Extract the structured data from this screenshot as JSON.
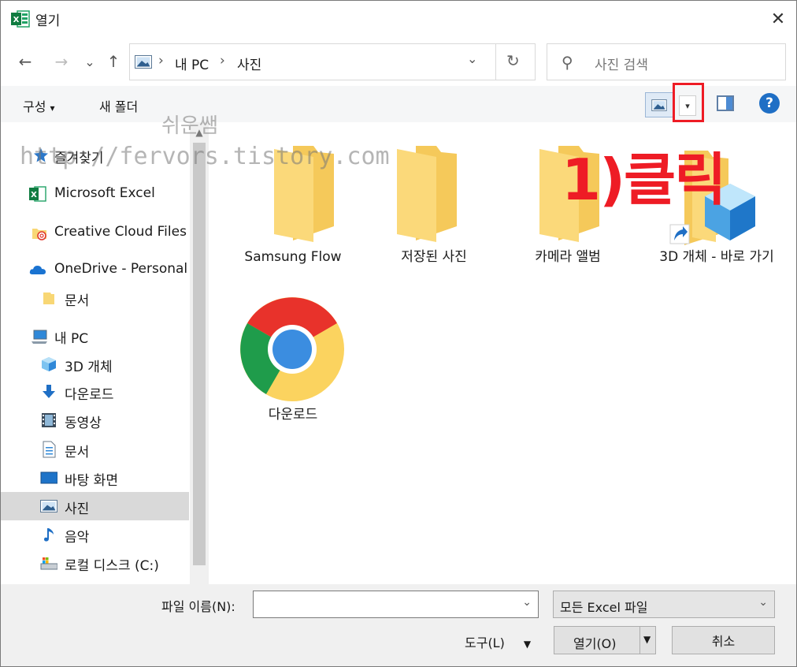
{
  "window": {
    "title": "열기",
    "close_glyph": "✕"
  },
  "nav": {
    "back_glyph": "←",
    "forward_glyph": "→",
    "recent_glyph": "⌄",
    "up_glyph": "↑",
    "breadcrumb": [
      "내 PC",
      "사진"
    ],
    "crumb_sep": "›",
    "dropdown_glyph": "⌄",
    "refresh_glyph": "↻"
  },
  "search": {
    "placeholder": "사진 검색"
  },
  "toolbar": {
    "organize": "구성",
    "organize_arrow": "▾",
    "new_folder": "새 폴더",
    "help": "?",
    "view_dd": "▾"
  },
  "sidebar": {
    "items": [
      {
        "label": "즐겨찾기",
        "icon": "star-icon"
      },
      {
        "label": "Microsoft Excel",
        "icon": "excel-icon"
      },
      {
        "label": "Creative Cloud Files",
        "icon": "creative-cloud-icon"
      },
      {
        "label": "OneDrive - Personal",
        "icon": "cloud-icon"
      },
      {
        "label": "문서",
        "icon": "folder-icon"
      },
      {
        "label": "내 PC",
        "icon": "pc-icon"
      },
      {
        "label": "3D 개체",
        "icon": "cube-icon"
      },
      {
        "label": "다운로드",
        "icon": "download-icon"
      },
      {
        "label": "동영상",
        "icon": "video-icon"
      },
      {
        "label": "문서",
        "icon": "document-icon"
      },
      {
        "label": "바탕 화면",
        "icon": "desktop-icon"
      },
      {
        "label": "사진",
        "icon": "pictures-icon"
      },
      {
        "label": "음악",
        "icon": "music-icon"
      },
      {
        "label": "로컬 디스크 (C:)",
        "icon": "drive-icon"
      }
    ],
    "scroll_up": "▲"
  },
  "files": [
    {
      "label": "Samsung Flow",
      "icon": "folder-icon"
    },
    {
      "label": "저장된 사진",
      "icon": "folder-icon"
    },
    {
      "label": "카메라 앨범",
      "icon": "folder-icon"
    },
    {
      "label": "3D 개체 - 바로 가기",
      "icon": "shortcut-icon"
    },
    {
      "label": "다운로드",
      "icon": "chrome-icon"
    }
  ],
  "annotation": {
    "text": "1)클릭"
  },
  "watermarks": {
    "line1": "쉬운쌤",
    "line2": "http://fervors.tistory.com",
    "corner": "쌤"
  },
  "footer": {
    "filename_label": "파일 이름(N):",
    "filename_value": "",
    "filetype_value": "모든 Excel 파일",
    "tools_label": "도구(L)",
    "open_label": "열기(O)",
    "cancel_label": "취소",
    "dd_glyph": "⌄",
    "arrow_glyph": "▼"
  },
  "colors": {
    "annotation_red": "#ee1c25",
    "folder_yellow": "#f8d775",
    "help_blue": "#1f6fc5"
  }
}
